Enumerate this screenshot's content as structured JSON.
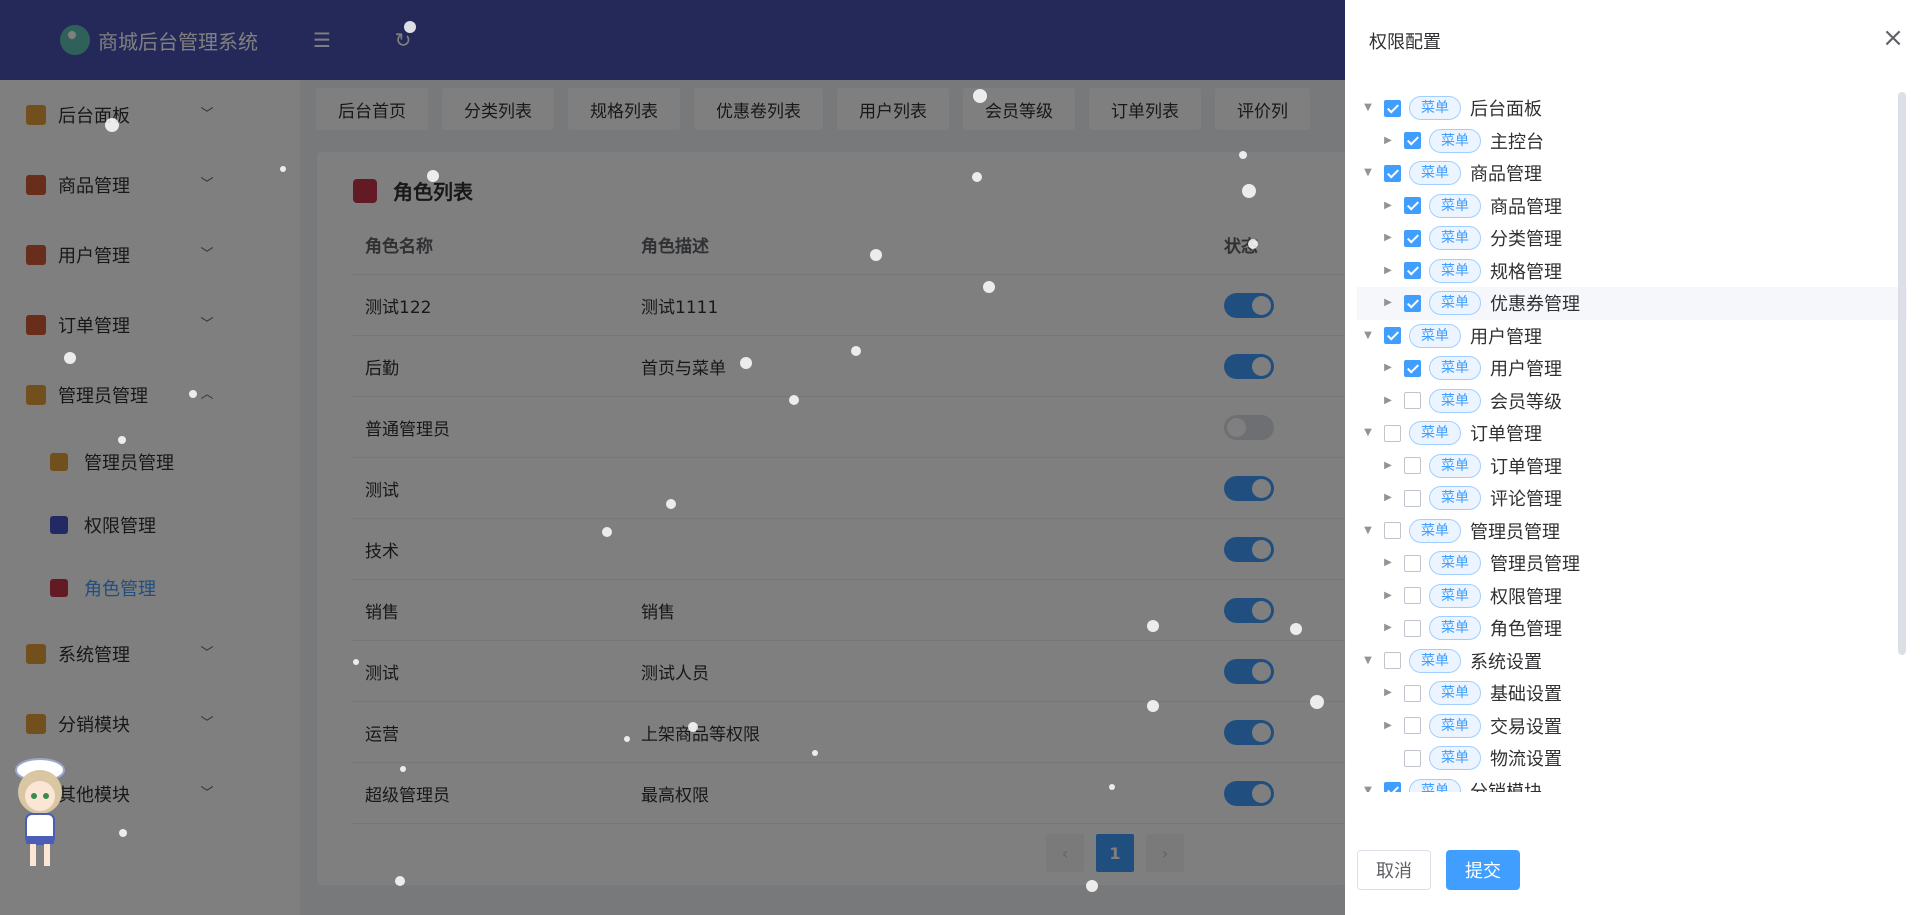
{
  "app": {
    "title": "商城后台管理系统"
  },
  "sidebar": {
    "items": [
      {
        "label": "后台面板",
        "icon": "home-icon",
        "color": "#e2a03c",
        "expanded": false
      },
      {
        "label": "商品管理",
        "icon": "shop-icon",
        "color": "#d35a36",
        "expanded": false
      },
      {
        "label": "用户管理",
        "icon": "user-icon",
        "color": "#d35a36",
        "expanded": false
      },
      {
        "label": "订单管理",
        "icon": "order-icon",
        "color": "#d35a36",
        "expanded": false
      },
      {
        "label": "管理员管理",
        "icon": "crown-icon",
        "color": "#e2a03c",
        "expanded": true,
        "children": [
          {
            "label": "管理员管理",
            "icon": "crown-icon",
            "color": "#e2a03c"
          },
          {
            "label": "权限管理",
            "icon": "gear-icon",
            "color": "#4752c4"
          },
          {
            "label": "角色管理",
            "icon": "role-icon",
            "color": "#c5364b",
            "active": true
          }
        ]
      },
      {
        "label": "系统管理",
        "icon": "medal-icon",
        "color": "#e2a03c",
        "expanded": false
      },
      {
        "label": "分销模块",
        "icon": "trophy-icon",
        "color": "#e2a03c",
        "expanded": false
      },
      {
        "label": "其他模块",
        "icon": "other-icon",
        "color": "#e2a03c",
        "expanded": false
      }
    ]
  },
  "tabs": [
    "后台首页",
    "分类列表",
    "规格列表",
    "优惠卷列表",
    "用户列表",
    "会员等级",
    "订单列表",
    "评价列"
  ],
  "role_list": {
    "title": "角色列表",
    "columns": [
      "角色名称",
      "角色描述",
      "状态"
    ],
    "rows": [
      {
        "name": "测试122",
        "desc": "测试1111",
        "enabled": true
      },
      {
        "name": "后勤",
        "desc": "首页与菜单",
        "enabled": true
      },
      {
        "name": "普通管理员",
        "desc": "",
        "enabled": false
      },
      {
        "name": "测试",
        "desc": "",
        "enabled": true
      },
      {
        "name": "技术",
        "desc": "",
        "enabled": true
      },
      {
        "name": "销售",
        "desc": "销售",
        "enabled": true
      },
      {
        "name": "测试",
        "desc": "测试人员",
        "enabled": true
      },
      {
        "name": "运营",
        "desc": "上架商品等权限",
        "enabled": true
      },
      {
        "name": "超级管理员",
        "desc": "最高权限",
        "enabled": true
      }
    ],
    "pagination": {
      "prev": "‹",
      "current": "1",
      "next": "›"
    }
  },
  "drawer": {
    "title": "权限配置",
    "tag_label": "菜单",
    "tree": [
      {
        "label": "后台面板",
        "level": 0,
        "checked": true,
        "caret": "expanded"
      },
      {
        "label": "主控台",
        "level": 1,
        "checked": true,
        "caret": "collapsed"
      },
      {
        "label": "商品管理",
        "level": 0,
        "checked": true,
        "caret": "expanded"
      },
      {
        "label": "商品管理",
        "level": 1,
        "checked": true,
        "caret": "collapsed"
      },
      {
        "label": "分类管理",
        "level": 1,
        "checked": true,
        "caret": "collapsed"
      },
      {
        "label": "规格管理",
        "level": 1,
        "checked": true,
        "caret": "collapsed"
      },
      {
        "label": "优惠券管理",
        "level": 1,
        "checked": true,
        "caret": "collapsed",
        "highlighted": true
      },
      {
        "label": "用户管理",
        "level": 0,
        "checked": true,
        "caret": "expanded"
      },
      {
        "label": "用户管理",
        "level": 1,
        "checked": true,
        "caret": "collapsed"
      },
      {
        "label": "会员等级",
        "level": 1,
        "checked": false,
        "caret": "collapsed"
      },
      {
        "label": "订单管理",
        "level": 0,
        "checked": false,
        "caret": "expanded"
      },
      {
        "label": "订单管理",
        "level": 1,
        "checked": false,
        "caret": "collapsed"
      },
      {
        "label": "评论管理",
        "level": 1,
        "checked": false,
        "caret": "collapsed"
      },
      {
        "label": "管理员管理",
        "level": 0,
        "checked": false,
        "caret": "expanded"
      },
      {
        "label": "管理员管理",
        "level": 1,
        "checked": false,
        "caret": "collapsed"
      },
      {
        "label": "权限管理",
        "level": 1,
        "checked": false,
        "caret": "collapsed"
      },
      {
        "label": "角色管理",
        "level": 1,
        "checked": false,
        "caret": "collapsed"
      },
      {
        "label": "系统设置",
        "level": 0,
        "checked": false,
        "caret": "expanded"
      },
      {
        "label": "基础设置",
        "level": 1,
        "checked": false,
        "caret": "collapsed"
      },
      {
        "label": "交易设置",
        "level": 1,
        "checked": false,
        "caret": "collapsed"
      },
      {
        "label": "物流设置",
        "level": 1,
        "checked": false,
        "caret": "none"
      },
      {
        "label": "分销模块",
        "level": 0,
        "checked": true,
        "caret": "expanded"
      }
    ],
    "cancel_label": "取消",
    "submit_label": "提交"
  },
  "colors": {
    "header": "#4852b5",
    "primary": "#409eff"
  }
}
